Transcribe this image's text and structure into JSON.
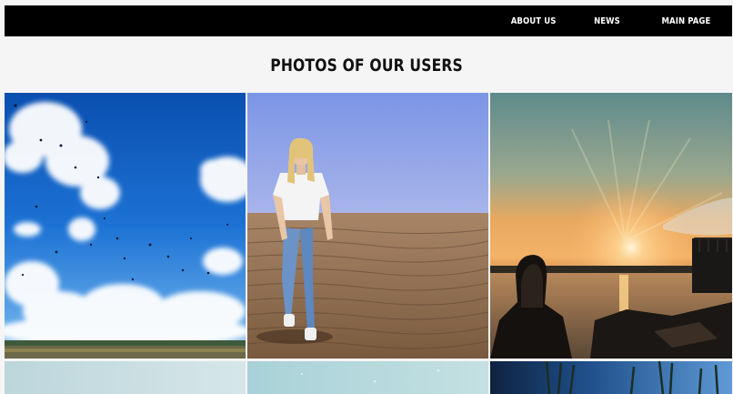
{
  "nav": {
    "about_label": "ABOUT US",
    "news_label": "NEWS",
    "main_label": "MAIN PAGE"
  },
  "page_title": "PHOTOS OF OUR USERS",
  "photos": [
    {
      "name": "sky-with-birds",
      "scene": "blue sky with clouds and flying birds"
    },
    {
      "name": "girl-on-beach",
      "scene": "girl walking on sandy beach"
    },
    {
      "name": "sunset-lake",
      "scene": "sunset over lake with person silhouette"
    },
    {
      "name": "pale-sky",
      "scene": "pale light sky"
    },
    {
      "name": "pale-water",
      "scene": "pale blue water"
    },
    {
      "name": "grass-and-sky",
      "scene": "grass stems against blue sky"
    }
  ],
  "colors": {
    "nav_bg": "#000000",
    "page_bg": "#f5f5f5"
  }
}
